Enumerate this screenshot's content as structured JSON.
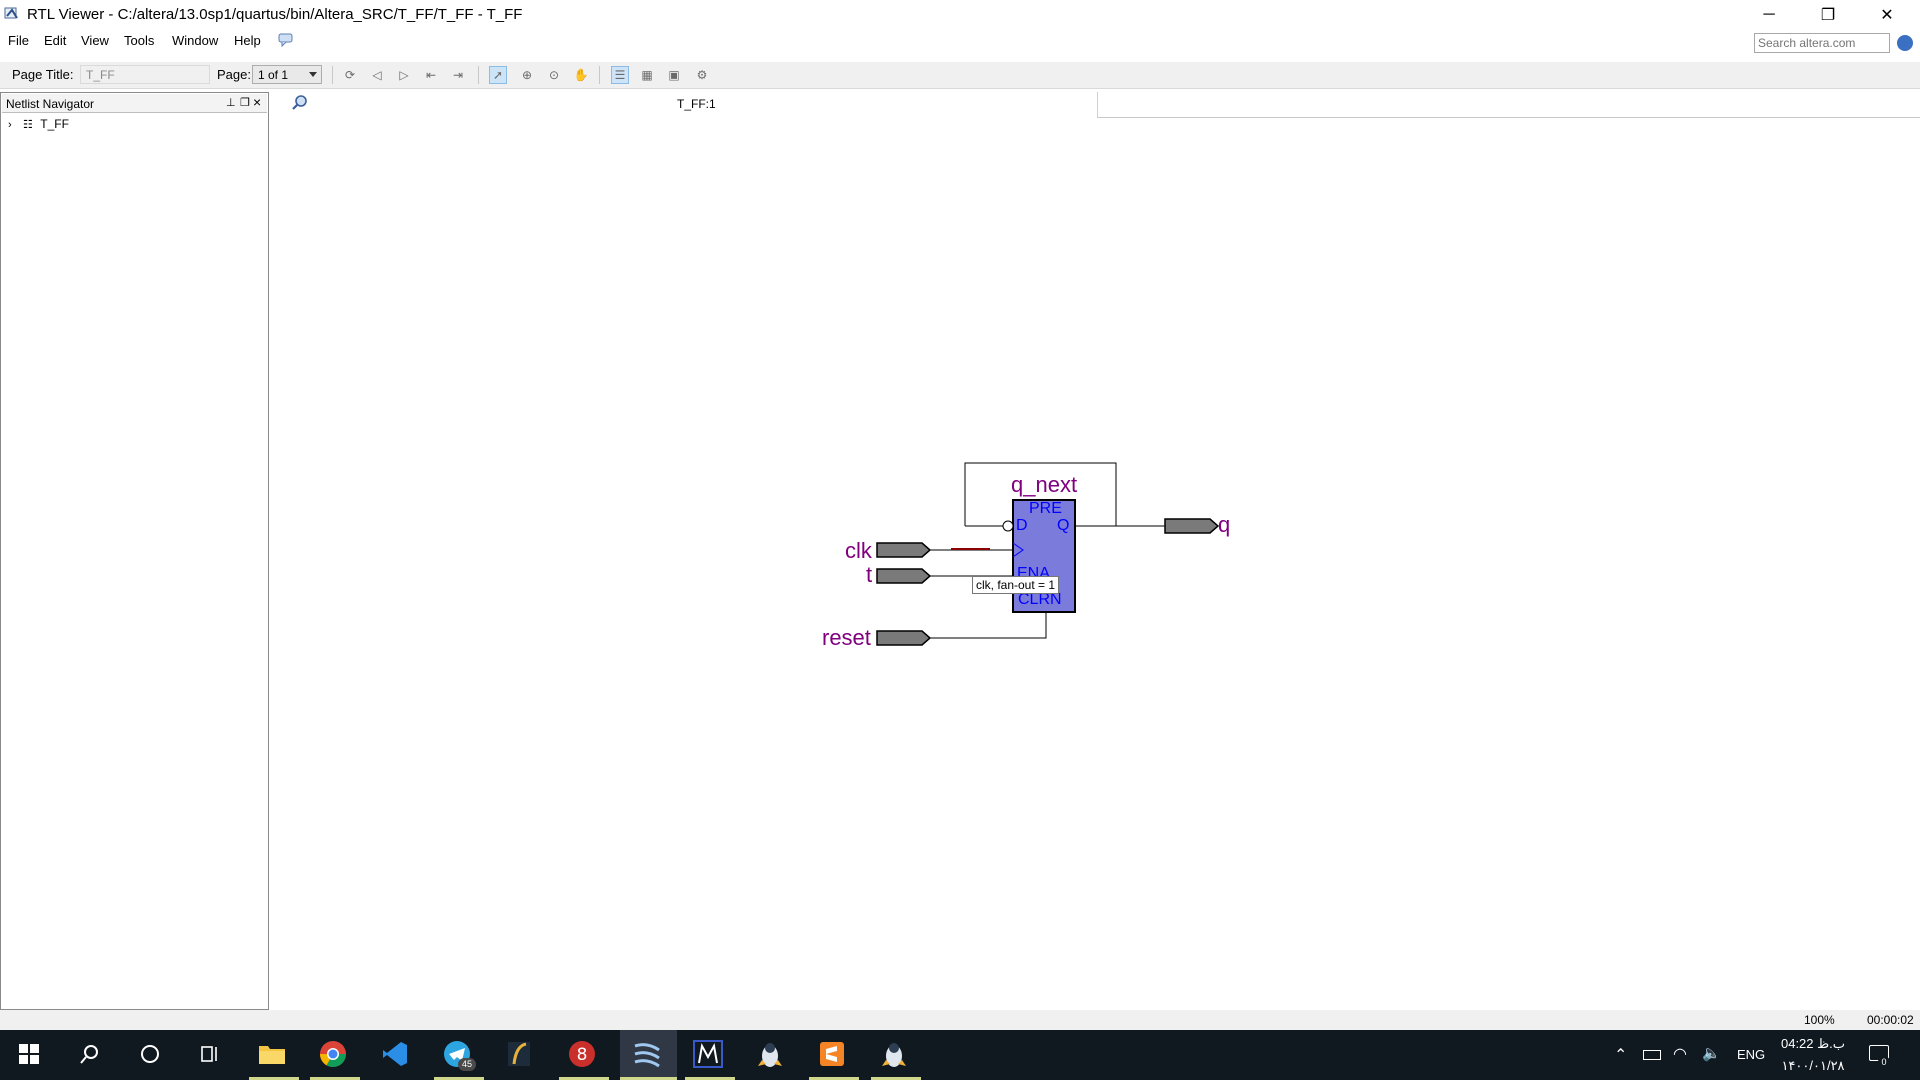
{
  "window": {
    "title": "RTL Viewer - C:/altera/13.0sp1/quartus/bin/Altera_SRC/T_FF/T_FF - T_FF",
    "minimize": "─",
    "restore": "❐",
    "close": "✕"
  },
  "menu": {
    "items": [
      "File",
      "Edit",
      "View",
      "Tools",
      "Window",
      "Help"
    ],
    "search_placeholder": "Search altera.com"
  },
  "toolbar": {
    "page_title_label": "Page Title:",
    "page_title_value": "T_FF",
    "page_label": "Page:",
    "page_value": "1 of 1"
  },
  "navigator": {
    "title": "Netlist Navigator",
    "pin": "⊥",
    "float": "❐",
    "close": "×",
    "tree_root": "T_FF"
  },
  "tab": {
    "label": "T_FF:1"
  },
  "schematic": {
    "register_name": "q_next",
    "pins": {
      "pre": "PRE",
      "d": "D",
      "q": "Q",
      "ena": "ENA",
      "clrn": "CLRN"
    },
    "inputs": [
      "clk",
      "t",
      "reset"
    ],
    "output": "q",
    "tooltip": "clk, fan-out = 1",
    "colors": {
      "register_fill": "#7b7bdb",
      "pin_text": "#0000ff",
      "signal_text": "#800080",
      "port_fill": "#7a7a7a",
      "highlight_wire": "#8b0000"
    }
  },
  "status": {
    "zoom": "100%",
    "elapsed": "00:00:02"
  },
  "taskbar": {
    "telegram_badge": "45",
    "language": "ENG",
    "time": "04:22 ب.ظ",
    "date": "۱۴۰۰/۰۱/۲۸",
    "notification_count": "0"
  }
}
